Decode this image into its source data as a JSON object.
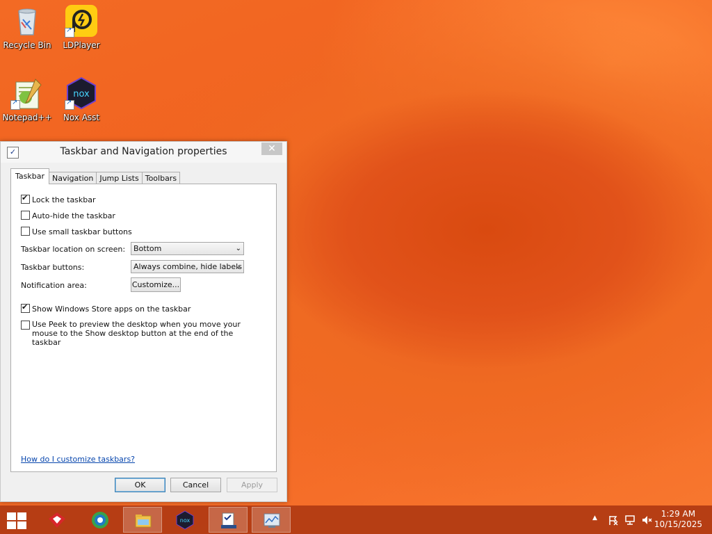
{
  "desktop": {
    "icons": [
      {
        "label": "Recycle Bin"
      },
      {
        "label": "LDPlayer"
      },
      {
        "label": "Notepad++"
      },
      {
        "label": "Nox Asst"
      }
    ]
  },
  "dialog": {
    "title": "Taskbar and Navigation properties",
    "close_glyph": "✕",
    "tabs": [
      {
        "label": "Taskbar",
        "active": true
      },
      {
        "label": "Navigation",
        "active": false
      },
      {
        "label": "Jump Lists",
        "active": false
      },
      {
        "label": "Toolbars",
        "active": false
      }
    ],
    "checkboxes": {
      "lock": {
        "label": "Lock the taskbar",
        "checked": true
      },
      "autohide": {
        "label": "Auto-hide the taskbar",
        "checked": false
      },
      "small_buttons": {
        "label": "Use small taskbar buttons",
        "checked": false
      },
      "store_apps": {
        "label": "Show Windows Store apps on the taskbar",
        "checked": true
      },
      "peek": {
        "label": "Use Peek to preview the desktop when you move your mouse to the Show desktop button at the end of the taskbar",
        "checked": false
      }
    },
    "location": {
      "label": "Taskbar location on screen:",
      "value": "Bottom"
    },
    "buttons_setting": {
      "label": "Taskbar buttons:",
      "value": "Always combine, hide labels"
    },
    "notification": {
      "label": "Notification area:",
      "button": "Customize..."
    },
    "help_link": "How do I customize taskbars?",
    "ok": "OK",
    "cancel": "Cancel",
    "apply": "Apply"
  },
  "taskbar": {
    "time": "1:29 AM",
    "date": "10/15/2025",
    "tray_chevron": "▲"
  },
  "colors": {
    "accent_link": "#0645ad",
    "taskbar": "#b03a12"
  }
}
